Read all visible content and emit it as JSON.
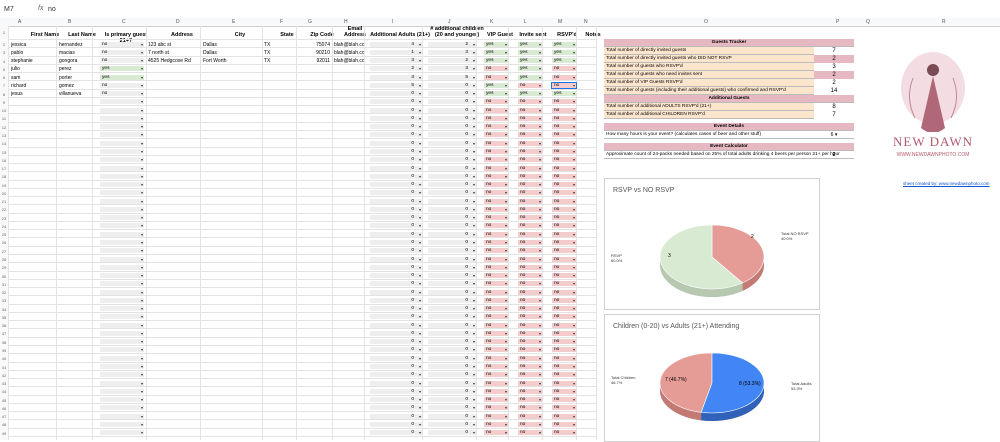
{
  "formula_bar": {
    "cell_ref": "M7",
    "fx": "fx",
    "value": "no"
  },
  "columns": [
    "A",
    "B",
    "C",
    "D",
    "E",
    "F",
    "G",
    "H",
    "I",
    "J",
    "K",
    "L",
    "M",
    "N",
    "O",
    "P",
    "Q",
    "R"
  ],
  "headers": {
    "first_name": "First Name",
    "last_name": "Last Name",
    "primary21": "Is primary guest 21+?",
    "address": "Address",
    "city": "City",
    "state": "State",
    "zip": "Zip Code",
    "email": "Email Address",
    "add_adults": "Additional Adults (21+)",
    "add_children": "# additional children (20 and younger)",
    "vip": "VIP Guest",
    "invite": "Invite sent",
    "rsvp": "RSVP'd",
    "notes": "Notes"
  },
  "guests": [
    {
      "first": "jessica",
      "last": "hernandez",
      "p21": "no",
      "address": "123 abc st",
      "city": "Dallas",
      "state": "TX",
      "zip": "75074",
      "email": "blah@blah.com",
      "adults": "4",
      "children": "2",
      "vip": "yes",
      "invite": "yes",
      "rsvp": "yes"
    },
    {
      "first": "pablo",
      "last": "macias",
      "p21": "no",
      "address": "7 north st",
      "city": "Dallas",
      "state": "TX",
      "zip": "90210",
      "email": "blah@blah.com",
      "adults": "1",
      "children": "3",
      "vip": "yes",
      "invite": "yes",
      "rsvp": "yes"
    },
    {
      "first": "stephanie",
      "last": "gongora",
      "p21": "no",
      "address": "4525 Hedgcoxe Rd",
      "city": "Fort Worth",
      "state": "TX",
      "zip": "92011",
      "email": "blah@blah.com",
      "adults": "3",
      "children": "2",
      "vip": "yes",
      "invite": "yes",
      "rsvp": "yes"
    },
    {
      "first": "julio",
      "last": "perez",
      "p21": "yes",
      "address": "",
      "city": "",
      "state": "",
      "zip": "",
      "email": "",
      "adults": "2",
      "children": "3",
      "vip": "no",
      "invite": "yes",
      "rsvp": "no"
    },
    {
      "first": "sam",
      "last": "porter",
      "p21": "yes",
      "address": "",
      "city": "",
      "state": "",
      "zip": "",
      "email": "",
      "adults": "3",
      "children": "5",
      "vip": "no",
      "invite": "yes",
      "rsvp": "no"
    },
    {
      "first": "richard",
      "last": "gomez",
      "p21": "no",
      "address": "",
      "city": "",
      "state": "",
      "zip": "",
      "email": "",
      "adults": "5",
      "children": "0",
      "vip": "yes",
      "invite": "no",
      "rsvp": "no"
    },
    {
      "first": "jesus",
      "last": "villanueva",
      "p21": "no",
      "address": "",
      "city": "",
      "state": "",
      "zip": "",
      "email": "",
      "adults": "0",
      "children": "0",
      "vip": "yes",
      "invite": "yes",
      "rsvp": "yes"
    }
  ],
  "empty_defaults": {
    "adults": "0",
    "children": "0",
    "vip": "no",
    "invite": "no",
    "rsvp": "no"
  },
  "colors": {
    "yes_green": "#d9ead3",
    "no_red": "#f4cccc",
    "pink_header": "#e6b8c2",
    "peach": "#fce5cd",
    "pie_red": "#e69c96",
    "pie_green": "#d9ead3",
    "pie_blue": "#4285f4"
  },
  "tracker": {
    "title": "Guests Tracker",
    "rows": [
      {
        "label": "Total number of directly invited guests",
        "value": "7"
      },
      {
        "label": "Total number of directly invited guests who DID NOT RSVP",
        "value": "2"
      },
      {
        "label": "Total number of guests who RSVP'd",
        "value": "3"
      },
      {
        "label": "Total number of guests who need invites sent",
        "value": "2"
      },
      {
        "label": "Total number of VIP Guests RSVP'd",
        "value": "2"
      },
      {
        "label": "Total number of guests (including their additional guests) who confirmed and RSVP'd",
        "value": "14"
      }
    ],
    "additional_title": "Additional Guests",
    "additional_rows": [
      {
        "label": "Total number of additional ADULTS RSVP'd (21+)",
        "value": "8"
      },
      {
        "label": "Total number of additional CHILDREN RSVP'd",
        "value": "7"
      }
    ],
    "event_details_title": "Event Details",
    "event_details_label": "How many hours is your event? (calculates cases of beer and other stuff)",
    "event_details_value": "6",
    "calculator_title": "Event Calculator",
    "calculator_label": "Approximate count of 24-packs needed based on 25% of total adults drinking 4 beers per person 21+ per hour",
    "calculator_value": "2"
  },
  "logo": {
    "name": "NEW DAWN",
    "sub": "WWW.NEWDAWNPHOTO.COM",
    "link": "sheet created by: www.newdawnphoto.com"
  },
  "chart_data": [
    {
      "type": "pie",
      "title": "RSVP vs NO RSVP",
      "series": [
        {
          "name": "Total NO RSVP",
          "value": 2,
          "label": "40.0%"
        },
        {
          "name": "RSVP",
          "value": 3,
          "label": "60.0%"
        }
      ]
    },
    {
      "type": "pie",
      "title": "Children (0-20) vs Adults (21+) Attending",
      "series": [
        {
          "name": "Total Children",
          "value": 7,
          "label": "46.7%",
          "inner": "7 (46.7%)"
        },
        {
          "name": "Total Adults",
          "value": 8,
          "label": "53.3%",
          "inner": "8 (53.3%)"
        }
      ]
    }
  ]
}
